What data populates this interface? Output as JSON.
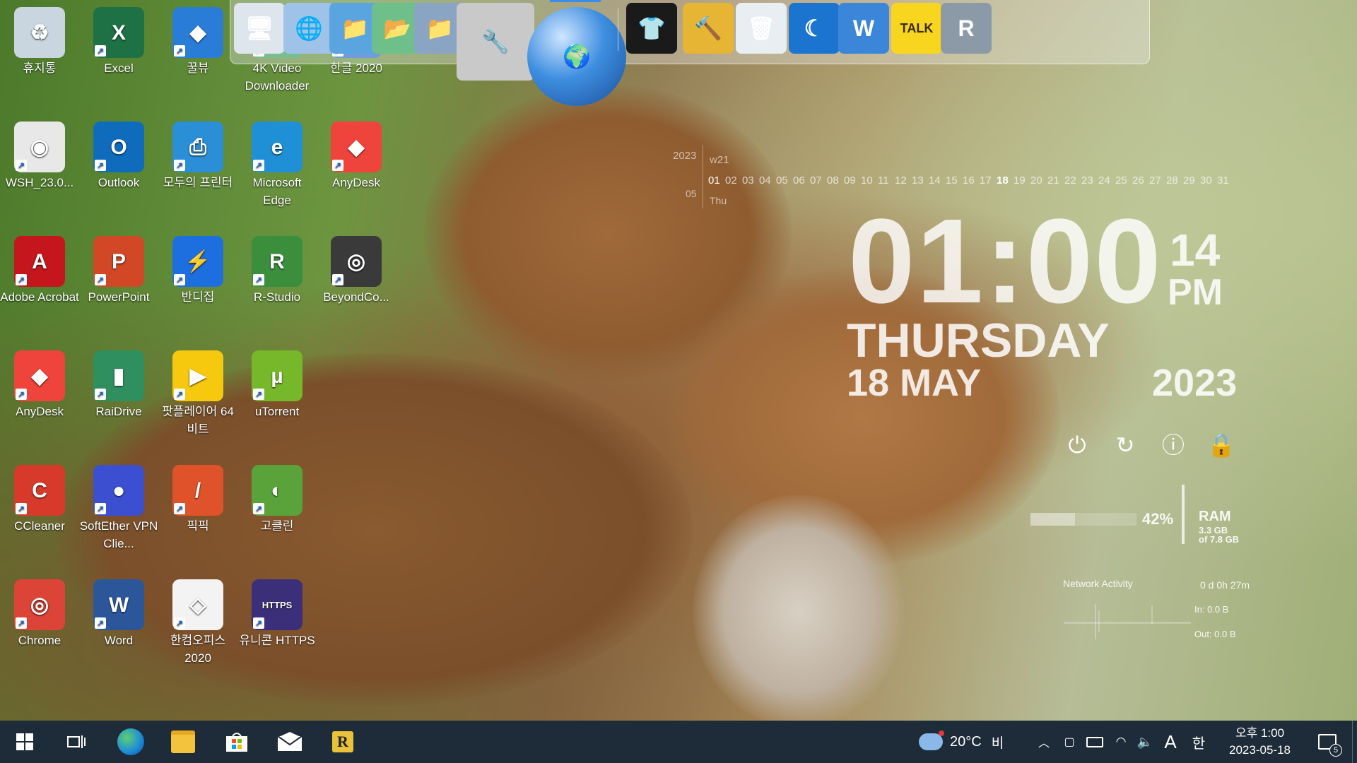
{
  "desktop": {
    "icons": [
      {
        "label": "휴지통",
        "glyph": "♻",
        "color": "#c9d6df"
      },
      {
        "label": "Excel",
        "glyph": "X",
        "color": "#1d7145"
      },
      {
        "label": "꿀뷰",
        "glyph": "◆",
        "color": "#2a7dd6"
      },
      {
        "label": "4K Video Downloader",
        "glyph": "▼",
        "color": "#3aa35c"
      },
      {
        "label": "한글 2020",
        "glyph": "ㅎ",
        "color": "#2c6fd1"
      },
      {
        "label": "WSH_23.0...",
        "glyph": "◉",
        "color": "#e8e8e8"
      },
      {
        "label": "Outlook",
        "glyph": "O",
        "color": "#0f6cbd"
      },
      {
        "label": "모두의 프린터",
        "glyph": "⎙",
        "color": "#2b8fd8"
      },
      {
        "label": "Microsoft Edge",
        "glyph": "e",
        "color": "#1f8fd6"
      },
      {
        "label": "AnyDesk",
        "glyph": "◆",
        "color": "#ef443b"
      },
      {
        "label": "Adobe Acrobat",
        "glyph": "A",
        "color": "#c4161c"
      },
      {
        "label": "PowerPoint",
        "glyph": "P",
        "color": "#d24726"
      },
      {
        "label": "반디집",
        "glyph": "⚡",
        "color": "#1d6fe0"
      },
      {
        "label": "R-Studio",
        "glyph": "R",
        "color": "#3b8f3c"
      },
      {
        "label": "BeyondCo...",
        "glyph": "◎",
        "color": "#3a3a3a"
      },
      {
        "label": "AnyDesk",
        "glyph": "◆",
        "color": "#ef443b"
      },
      {
        "label": "RaiDrive",
        "glyph": "▮",
        "color": "#2f8f5f"
      },
      {
        "label": "팟플레이어 64 비트",
        "glyph": "▶",
        "color": "#f6c90e"
      },
      {
        "label": "uTorrent",
        "glyph": "µ",
        "color": "#76b82a"
      },
      {
        "label": "CCleaner",
        "glyph": "C",
        "color": "#d73a2a"
      },
      {
        "label": "SoftEther VPN Clie...",
        "glyph": "●",
        "color": "#3b4fd0"
      },
      {
        "label": "픽픽",
        "glyph": "/",
        "color": "#e0532a"
      },
      {
        "label": "고클린",
        "glyph": "◐",
        "color": "#5aa23a"
      },
      {
        "label": "Chrome",
        "glyph": "◎",
        "color": "#db4437"
      },
      {
        "label": "Word",
        "glyph": "W",
        "color": "#2b579a"
      },
      {
        "label": "한컴오피스 2020",
        "glyph": "◇",
        "color": "#f3f3f3"
      },
      {
        "label": "유니콘 HTTPS",
        "glyph": "HTTPS",
        "color": "#3c2f7a"
      }
    ]
  },
  "dock": {
    "icons": [
      {
        "name": "computer-icon",
        "glyph": "🖥"
      },
      {
        "name": "network-globe-icon",
        "glyph": "🌐"
      },
      {
        "name": "folder-icon",
        "glyph": "📁"
      },
      {
        "name": "folder-green-icon",
        "glyph": "📂"
      },
      {
        "name": "folder-gear-icon",
        "glyph": "📁"
      },
      {
        "name": "tools-icon",
        "glyph": "🔧"
      },
      {
        "name": "globe-rocket-icon",
        "glyph": "🌍"
      },
      {
        "name": "tshirt-icon",
        "glyph": "👕"
      },
      {
        "name": "hammer-icon",
        "glyph": "🔨"
      },
      {
        "name": "recycle-bin-icon",
        "glyph": "🗑"
      },
      {
        "name": "moon-icon",
        "glyph": "☾"
      },
      {
        "name": "shield-w-icon",
        "glyph": "W"
      },
      {
        "name": "kakaotalk-icon",
        "glyph": "TALK"
      },
      {
        "name": "registry-icon",
        "glyph": "R"
      }
    ]
  },
  "calendar": {
    "year": "2023",
    "week": "w21",
    "month": "05",
    "weekday_short": "Thu",
    "days": [
      "01",
      "02",
      "03",
      "04",
      "05",
      "06",
      "07",
      "08",
      "09",
      "10",
      "11",
      "12",
      "13",
      "14",
      "15",
      "16",
      "17",
      "18",
      "19",
      "20",
      "21",
      "22",
      "23",
      "24",
      "25",
      "26",
      "27",
      "28",
      "29",
      "30",
      "31"
    ],
    "current_day": "18"
  },
  "clock": {
    "time": "01:00",
    "seconds": "14",
    "ampm": "PM",
    "weekday": "THURSDAY",
    "date": "18 MAY",
    "year": "2023"
  },
  "power_buttons": [
    {
      "name": "power-icon",
      "glyph": "⏻"
    },
    {
      "name": "restart-icon",
      "glyph": "↻"
    },
    {
      "name": "logoff-icon",
      "glyph": "ⓘ"
    },
    {
      "name": "lock-icon",
      "glyph": "🔒"
    }
  ],
  "ram": {
    "percent_label": "42%",
    "percent": 42,
    "title": "RAM",
    "used": "3.3 GB",
    "total": "of 7.8 GB"
  },
  "network": {
    "title": "Network Activity",
    "uptime": "0 d 0h 27m",
    "in": "In: 0.0 B",
    "out": "Out: 0.0 B"
  },
  "taskbar": {
    "weather_temp": "20°C",
    "weather_desc": "비",
    "ime_mode": "A",
    "ime_lang": "한",
    "clock_time": "오후 1:00",
    "clock_date": "2023-05-18",
    "notification_count": "5"
  }
}
